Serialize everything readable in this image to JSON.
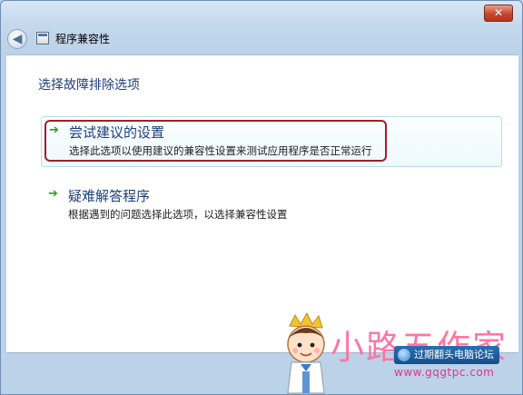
{
  "window": {
    "title": "程序兼容性",
    "close_label": "✕"
  },
  "content": {
    "heading": "选择故障排除选项",
    "options": [
      {
        "title": "尝试建议的设置",
        "description": "选择此选项以使用建议的兼容性设置来测试应用程序是否正常运行"
      },
      {
        "title": "疑难解答程序",
        "description": "根据遇到的问题选择此选项，以选择兼容性设置"
      }
    ]
  },
  "watermark": {
    "brand_text": "小路五作家",
    "badge_text": "过期翻头电脑论坛",
    "url": "www.gqgtpc.com"
  },
  "colors": {
    "heading": "#1e3e79",
    "highlight": "#a51c2a",
    "arrow": "#2e9a2e"
  }
}
